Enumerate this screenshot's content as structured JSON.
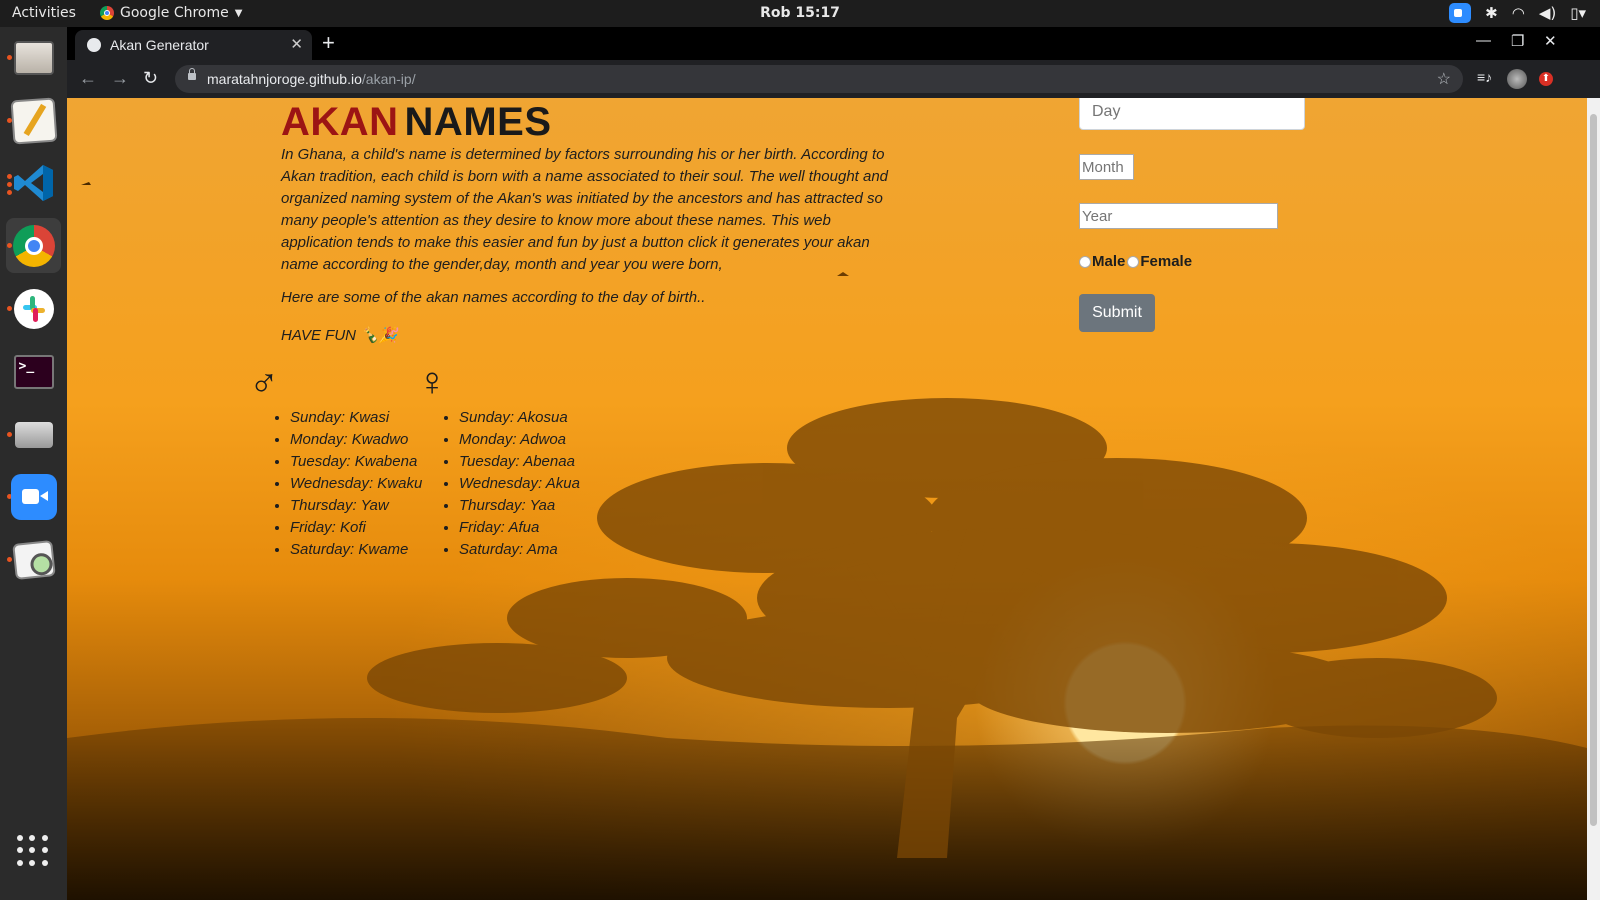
{
  "topbar": {
    "activities": "Activities",
    "app_name": "Google Chrome",
    "clock": "Rob 15:17"
  },
  "dock": {
    "items": [
      "files-icon",
      "text-editor-icon",
      "vscode-icon",
      "chrome-icon",
      "slack-icon",
      "terminal-icon",
      "scanner-icon",
      "zoom-icon",
      "image-viewer-icon"
    ],
    "active": "chrome-icon",
    "accent": "#e95420"
  },
  "browser": {
    "tab_title": "Akan Generator",
    "url_host": "maratahnjoroge.github.io",
    "url_path": "/akan-ip/"
  },
  "page": {
    "title_akan": "AKAN",
    "title_names": "NAMES",
    "title_akan_color": "#9c1414",
    "intro": "In Ghana, a child's name is determined by factors surrounding his or her birth. According to Akan tradition, each child is born with a name associated to their soul. The well thought and organized naming system of the Akan's was initiated by the ancestors and has attracted so many people's attention as they desire to know more about these names. This web application tends to make this easier and fun by just a button click it generates your akan name according to the gender,day, month and year you were born,",
    "subtitle": "Here are some of the akan names according to the day of birth..",
    "have_fun": "HAVE FUN 🍾🎉",
    "male_symbol": "♂",
    "female_symbol": "♀",
    "male_names": [
      "Sunday: Kwasi",
      "Monday: Kwadwo",
      "Tuesday: Kwabena",
      "Wednesday: Kwaku",
      "Thursday: Yaw",
      "Friday: Kofi",
      "Saturday: Kwame"
    ],
    "female_names": [
      "Sunday: Akosua",
      "Monday: Adwoa",
      "Tuesday: Abenaa",
      "Wednesday: Akua",
      "Thursday: Yaa",
      "Friday: Afua",
      "Saturday: Ama"
    ]
  },
  "form": {
    "day_placeholder": "Day",
    "month_placeholder": "Month",
    "year_placeholder": "Year",
    "male_label": "Male",
    "female_label": "Female",
    "submit_label": "Submit",
    "submit_color": "#6c757d"
  }
}
